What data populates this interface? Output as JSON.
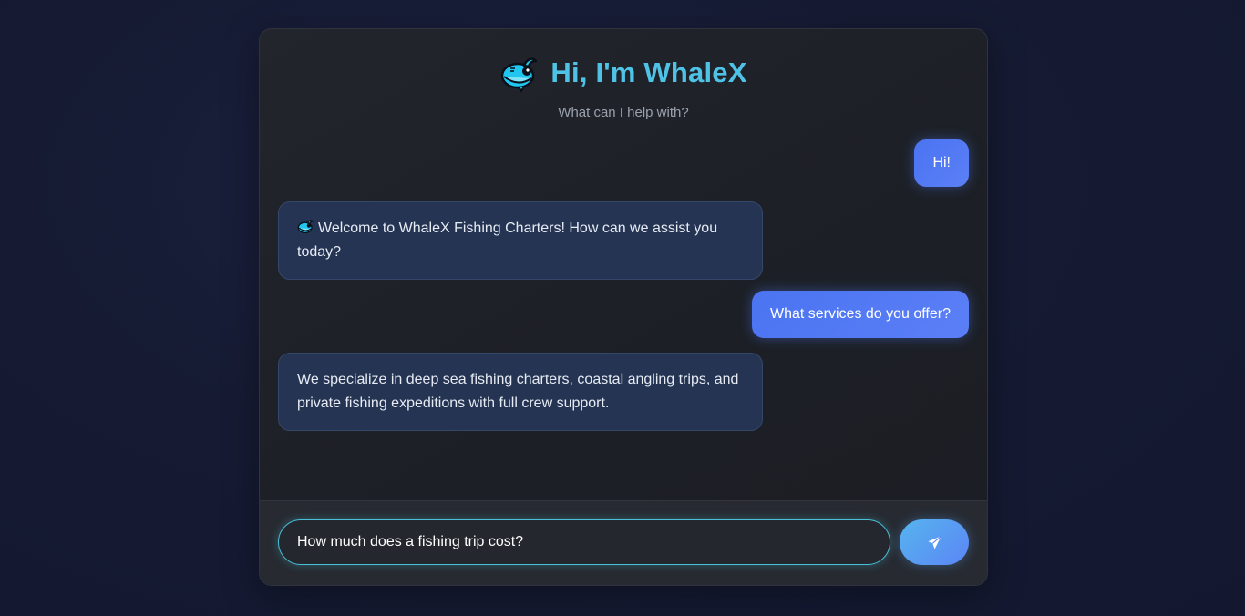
{
  "header": {
    "logo_icon": "whale-icon",
    "title": "Hi, I'm WhaleX",
    "subtitle": "What can I help with?",
    "accent_color": "#4fc3e6"
  },
  "messages": [
    {
      "role": "user",
      "text": "Hi!"
    },
    {
      "role": "bot",
      "icon": "whale-icon",
      "text": "Welcome to WhaleX Fishing Charters! How can we assist you today?"
    },
    {
      "role": "user",
      "text": "What services do you offer?"
    },
    {
      "role": "bot",
      "text": "We specialize in deep sea fishing charters, coastal angling trips, and private fishing expeditions with full crew support."
    }
  ],
  "composer": {
    "input_value": "How much does a fishing trip cost?",
    "send_icon": "paper-plane-icon"
  },
  "colors": {
    "user_bubble": "#4b74f2",
    "bot_bubble": "#253452",
    "background": "#161b33"
  }
}
